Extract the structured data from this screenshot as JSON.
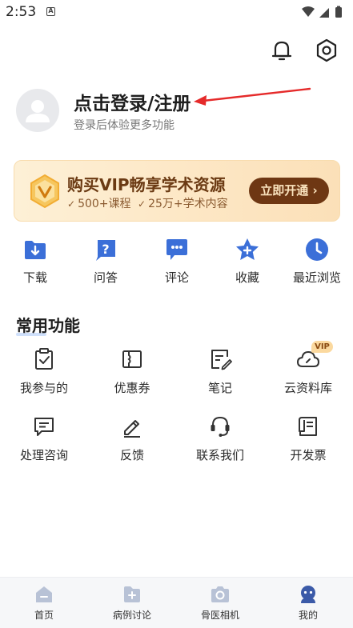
{
  "status_bar": {
    "time": "2:53",
    "notification_letter": "A"
  },
  "profile": {
    "title": "点击登录/注册",
    "subtitle": "登录后体验更多功能"
  },
  "vip": {
    "title": "购买VIP畅享学术资源",
    "feature_1": "500+课程",
    "feature_2": "25万+学术内容",
    "check": "✓",
    "button": "立即开通 ›"
  },
  "quick_actions": [
    {
      "label": "下载",
      "icon": "download-icon"
    },
    {
      "label": "问答",
      "icon": "question-icon"
    },
    {
      "label": "评论",
      "icon": "comment-icon"
    },
    {
      "label": "收藏",
      "icon": "star-icon"
    },
    {
      "label": "最近浏览",
      "icon": "clock-icon"
    }
  ],
  "section": {
    "title": "常用功能"
  },
  "functions": [
    {
      "label": "我参与的",
      "icon": "clipboard-check-icon"
    },
    {
      "label": "优惠券",
      "icon": "coupon-icon"
    },
    {
      "label": "笔记",
      "icon": "note-icon"
    },
    {
      "label": "云资料库",
      "icon": "cloud-icon",
      "tag": "VIP"
    },
    {
      "label": "处理咨询",
      "icon": "chat-icon"
    },
    {
      "label": "反馈",
      "icon": "pen-icon"
    },
    {
      "label": "联系我们",
      "icon": "headset-icon"
    },
    {
      "label": "开发票",
      "icon": "invoice-icon"
    }
  ],
  "bottom_nav": [
    {
      "label": "首页",
      "icon": "home-icon",
      "active": false
    },
    {
      "label": "病例讨论",
      "icon": "case-discussion-icon",
      "active": false
    },
    {
      "label": "骨医相机",
      "icon": "camera-icon",
      "active": false
    },
    {
      "label": "我的",
      "icon": "profile-icon",
      "active": true
    }
  ],
  "colors": {
    "accent_blue": "#3b6fd8",
    "vip_brown": "#6e3713",
    "vip_bg": "#fde7c5",
    "nav_inactive": "#b8c2d6",
    "arrow_red": "#e52a2a"
  }
}
